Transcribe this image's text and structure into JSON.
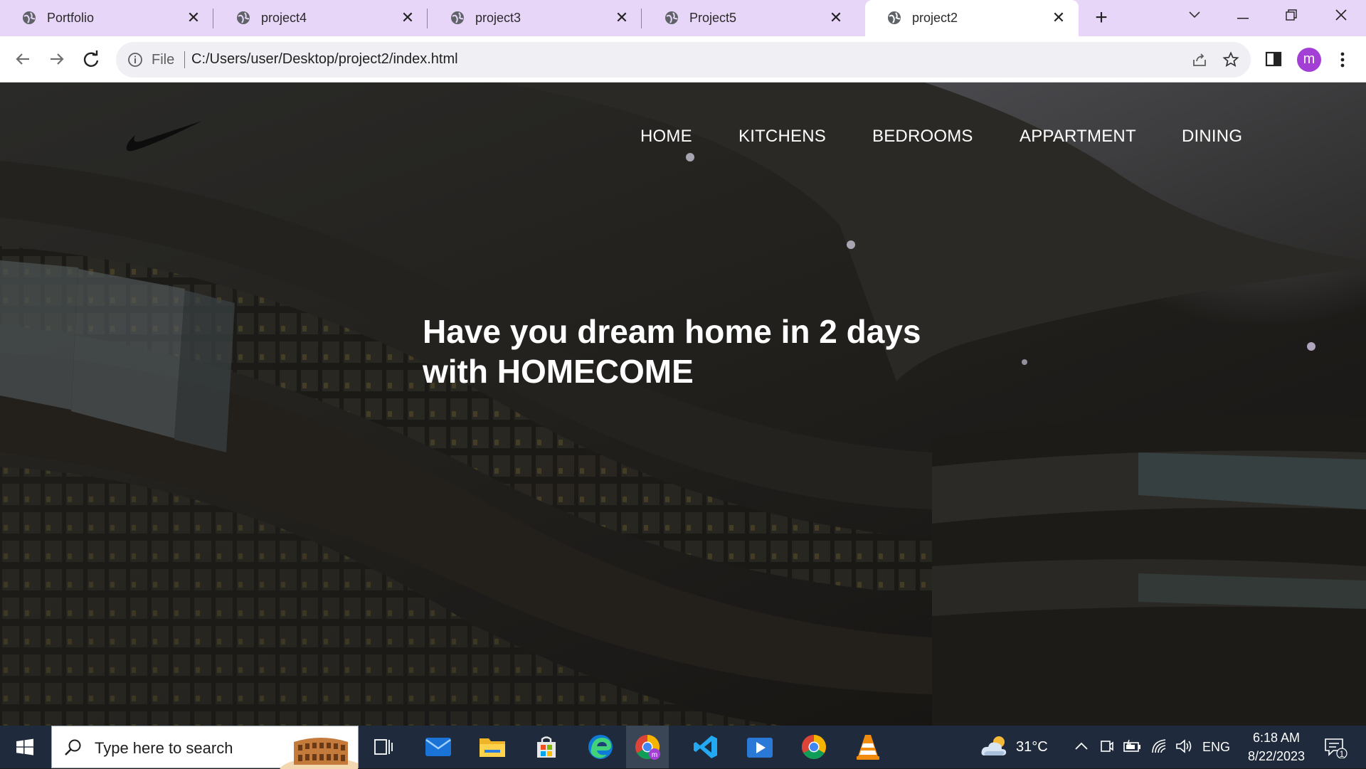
{
  "browser": {
    "tabs": [
      {
        "title": "Portfolio",
        "active": false
      },
      {
        "title": "project4",
        "active": false
      },
      {
        "title": "project3",
        "active": false
      },
      {
        "title": "Project5",
        "active": false
      },
      {
        "title": "project2",
        "active": true
      }
    ],
    "address": {
      "scheme_label": "File",
      "url": "C:/Users/user/Desktop/project2/index.html"
    },
    "profile_initial": "m",
    "colors": {
      "tabstrip": "#e8d6f9",
      "avatar": "#a43fd6"
    }
  },
  "site": {
    "nav": [
      "HOME",
      "KITCHENS",
      "BEDROOMS",
      "APPARTMENT",
      "DINING"
    ],
    "hero_line1": "Have you dream home in 2 days",
    "hero_line2": "with HOMECOME"
  },
  "taskbar": {
    "search_placeholder": "Type here to search",
    "apps": [
      "task-view",
      "mail",
      "file-explorer",
      "microsoft-store",
      "edge",
      "chrome-profile",
      "vscode",
      "media-player",
      "chrome",
      "vlc"
    ],
    "weather": "31°C",
    "language": "ENG",
    "time": "6:18 AM",
    "date": "8/22/2023",
    "notification_count": "1"
  }
}
